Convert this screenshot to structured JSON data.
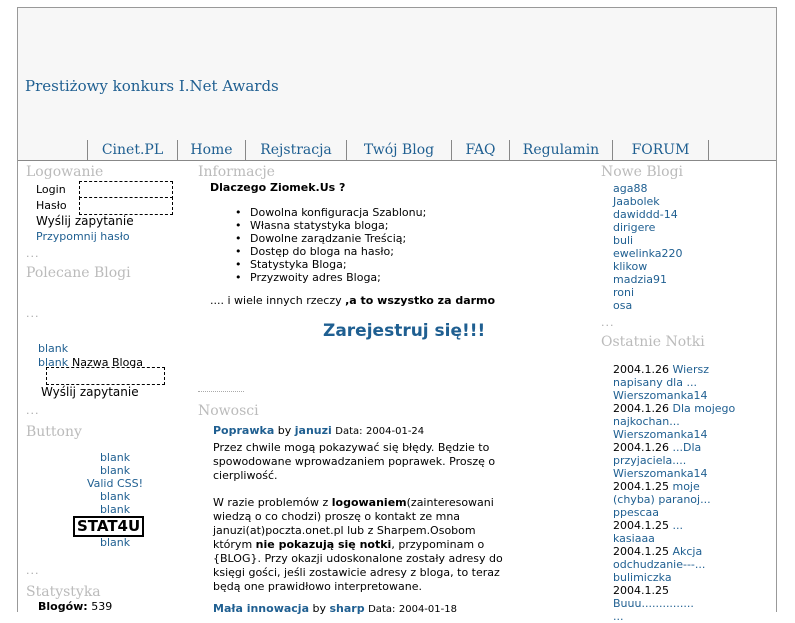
{
  "header": {
    "promo": "Prestiżowy konkurs I.Net Awards",
    "nav": [
      "Cinet.PL",
      "Home",
      "Rejstracja",
      "Twój Blog",
      "FAQ",
      "Regulamin",
      "FORUM"
    ]
  },
  "left": {
    "login_title": "Logowanie",
    "login_label": "Login",
    "password_label": "Hasło",
    "send_query": "Wyślij zapytanie",
    "remind_password": "Przypomnij hasło",
    "dots": "...",
    "recommended_title": "Polecane Blogi",
    "blank1": "blank",
    "blank2": "blank",
    "blog_name_label": "Nazwa Bloga",
    "send_query2": "Wyślij zapytanie",
    "buttons_title": "Buttony",
    "buttons": [
      "blank",
      "blank",
      "Valid CSS!",
      "blank",
      "blank"
    ],
    "stat4u": "STAT4U",
    "last_blank": "blank",
    "stats_title": "Statystyka",
    "blogs_label": "Blogów:",
    "blogs_count": "539"
  },
  "main": {
    "info_title": "Informacje",
    "why_title": "Dlaczego Ziomek.Us ?",
    "features": [
      "Dowolna konfiguracja Szablonu;",
      "Własna statystyka bloga;",
      "Dowolne zarądzanie Treścią;",
      "Dostęp do bloga na hasło;",
      "Statystyka Bloga;",
      "Przyzwoity adres Bloga;"
    ],
    "more_prefix": ".... i wiele innych rzeczy ",
    "more_bold": ",a to wszystko za darmo",
    "register": "Zarejestruj się!!!",
    "news_title": "Nowosci",
    "news1": {
      "title": "Poprawka",
      "by": "by",
      "author": "januzi",
      "date_label": "Data:",
      "date": "2004-01-24",
      "p1": "Przez chwile mogą pokazywać się błędy. Będzie to spowodowane wprowadzaniem poprawek. Proszę o cierpliwość.",
      "p2_a": "W razie problemów z ",
      "p2_b": "logowaniem",
      "p2_c": "(zainteresowani wiedzą o co chodzi) proszę o kontakt ze mna januzi(at)poczta.onet.pl lub z Sharpem.Osobom którym ",
      "p2_d": "nie pokazują się notki",
      "p2_e": ", przypominam o {BLOG}. Przy okazji udoskonalone zostały adresy do księgi gości, jeśli zostawicie adresy z bloga, to teraz będą one prawidłowo interpretowane."
    },
    "news2": {
      "title": "Mała innowacja",
      "by": "by",
      "author": "sharp",
      "date_label": "Data:",
      "date": "2004-01-18"
    }
  },
  "right": {
    "new_blogs_title": "Nowe Blogi",
    "new_blogs": [
      "aga88",
      "Jaabolek",
      "dawiddd-14",
      "dirigere",
      "buli",
      "ewelinka220",
      "klikow",
      "madzia91",
      "roni",
      "osa"
    ],
    "last_notes_title": "Ostatnie Notki",
    "notes": [
      {
        "date": "2004.1.26",
        "title": "Wiersz napisany dla ...",
        "author": "Wierszomanka14"
      },
      {
        "date": "2004.1.26",
        "title": "Dla mojego najkochan...",
        "author": "Wierszomanka14"
      },
      {
        "date": "2004.1.26",
        "title": "...Dla przyjaciela....",
        "author": "Wierszomanka14"
      },
      {
        "date": "2004.1.25",
        "title": "moje (chyba) paranoj...",
        "author": "ppescaa"
      },
      {
        "date": "2004.1.25",
        "title": "...",
        "author": "kasiaaa"
      },
      {
        "date": "2004.1.25",
        "title": "Akcja odchudzanie---...",
        "author": "bulimiczka"
      },
      {
        "date": "2004.1.25",
        "title": "Buuu...............",
        "author": "..."
      }
    ]
  }
}
